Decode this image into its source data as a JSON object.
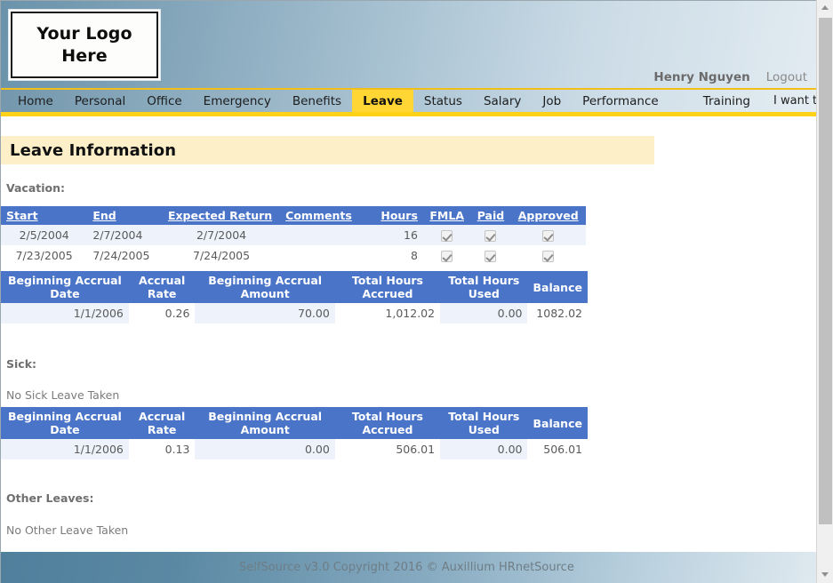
{
  "header": {
    "logo_line1": "Your Logo",
    "logo_line2": "Here",
    "username": "Henry Nguyen",
    "logout_label": "Logout"
  },
  "nav": {
    "items": [
      {
        "label": "Home",
        "active": false
      },
      {
        "label": "Personal",
        "active": false
      },
      {
        "label": "Office",
        "active": false
      },
      {
        "label": "Emergency",
        "active": false
      },
      {
        "label": "Benefits",
        "active": false
      },
      {
        "label": "Leave",
        "active": true
      },
      {
        "label": "Status",
        "active": false
      },
      {
        "label": "Salary",
        "active": false
      },
      {
        "label": "Job",
        "active": false
      },
      {
        "label": "Performance",
        "active": false
      },
      {
        "label": "Training",
        "active": false
      },
      {
        "label": "I want to...",
        "active": false
      }
    ],
    "more_arrow_icon": "triangle-right-icon"
  },
  "main": {
    "page_title": "Leave Information",
    "vacation": {
      "label": "Vacation:",
      "columns": [
        "Start",
        "End",
        "Expected Return",
        "Comments",
        "Hours",
        "FMLA",
        "Paid",
        "Approved"
      ],
      "rows": [
        {
          "start": "2/5/2004",
          "end": "2/7/2004",
          "expected_return": "2/7/2004",
          "comments": "",
          "hours": "16",
          "fmla": true,
          "paid": true,
          "approved": true
        },
        {
          "start": "7/23/2005",
          "end": "7/24/2005",
          "expected_return": "7/24/2005",
          "comments": "",
          "hours": "8",
          "fmla": true,
          "paid": true,
          "approved": true
        }
      ],
      "accrual_columns": [
        "Beginning Accrual Date",
        "Accrual Rate",
        "Beginning Accrual Amount",
        "Total Hours Accrued",
        "Total Hours Used",
        "Balance"
      ],
      "accrual_row": {
        "beginning_accrual_date": "1/1/2006",
        "accrual_rate": "0.26",
        "beginning_accrual_amount": "70.00",
        "total_hours_accrued": "1,012.02",
        "total_hours_used": "0.00",
        "balance": "1082.02"
      }
    },
    "sick": {
      "label": "Sick:",
      "empty_note": "No Sick Leave Taken",
      "accrual_columns": [
        "Beginning Accrual Date",
        "Accrual Rate",
        "Beginning Accrual Amount",
        "Total Hours Accrued",
        "Total Hours Used",
        "Balance"
      ],
      "accrual_row": {
        "beginning_accrual_date": "1/1/2006",
        "accrual_rate": "0.13",
        "beginning_accrual_amount": "0.00",
        "total_hours_accrued": "506.01",
        "total_hours_used": "0.00",
        "balance": "506.01"
      }
    },
    "other": {
      "label": "Other Leaves:",
      "empty_note": "No Other Leave Taken"
    }
  },
  "footer": {
    "text": "SelfSource v3.0 Copyright 2016 © Auxillium HRnetSource"
  },
  "colors": {
    "accent_yellow": "#ffd633",
    "table_header_blue": "#4a74c8",
    "title_bar_cream": "#fdf0c8",
    "row_alt": "#eef2fb"
  }
}
